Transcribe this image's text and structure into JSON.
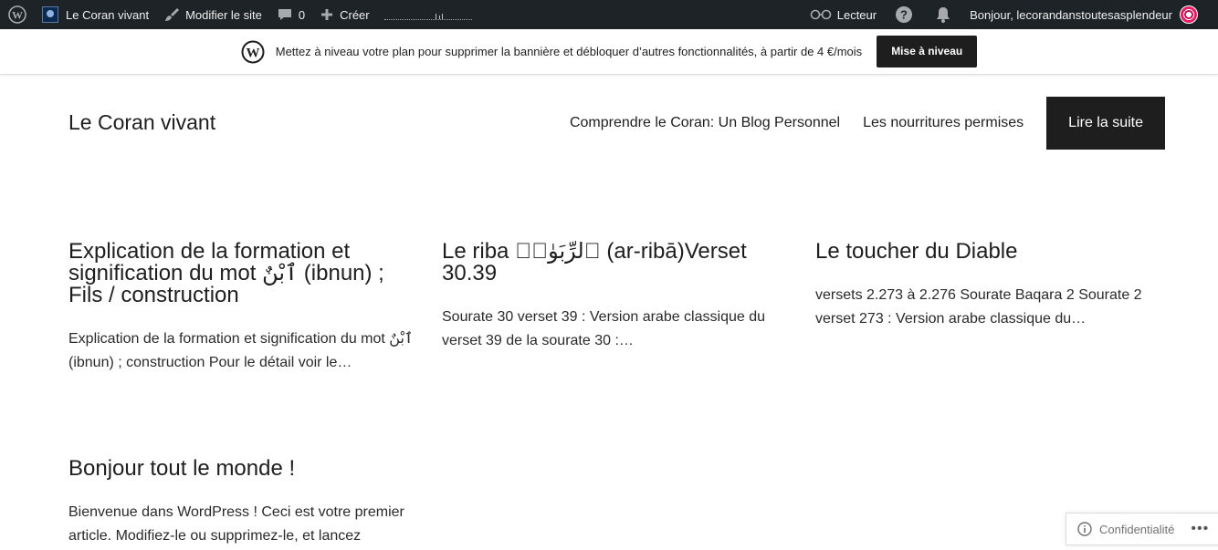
{
  "adminbar": {
    "site_name": "Le Coran vivant",
    "edit_site": "Modifier le site",
    "comments_count": "0",
    "create": "Créer",
    "reader": "Lecteur",
    "greeting": "Bonjour, lecorandanstoutesasplendeur",
    "icons": [
      "wordpress-icon",
      "site-icon",
      "brush-icon",
      "comment-icon",
      "plus-icon",
      "glasses-icon",
      "help-icon",
      "bell-icon",
      "avatar"
    ]
  },
  "banner": {
    "message": "Mettez à niveau votre plan pour supprimer la bannière et débloquer d’autres fonctionnalités, à partir de 4 €/mois",
    "button": "Mise à niveau"
  },
  "site": {
    "title": "Le Coran vivant",
    "nav": [
      "Comprendre le Coran: Un Blog Personnel",
      "Les nourritures permises",
      "Lire la suite"
    ]
  },
  "posts": [
    {
      "title": "Explication de la formation et signification du mot ٱبْنٌ (ibnun) ; Fils / construction",
      "excerpt": "Explication de la formation et signification du mot ٱبْنٌ (ibnun) ; construction Pour le détail voir le…"
    },
    {
      "title": "Le riba ٱلرِّبَوٰا۟ (ar-ribā)Verset 30.39",
      "excerpt": "Sourate 30 verset 39 : Version arabe classique du verset 39 de la sourate 30 :…"
    },
    {
      "title": "Le toucher du Diable",
      "excerpt": "versets 2.273 à 2.276 Sourate Baqara 2 Sourate 2 verset 273 : Version arabe classique du…"
    },
    {
      "title": "Bonjour tout le monde !",
      "excerpt": "Bienvenue dans WordPress ! Ceci est votre premier article. Modifiez-le ou supprimez-le, et lancez"
    }
  ],
  "privacy": {
    "label": "Confidentialité",
    "more": "•••"
  },
  "colors": {
    "adminbar_bg": "#1d2327",
    "text": "#1e1e1e",
    "cta_bg": "#1e1e1e"
  }
}
